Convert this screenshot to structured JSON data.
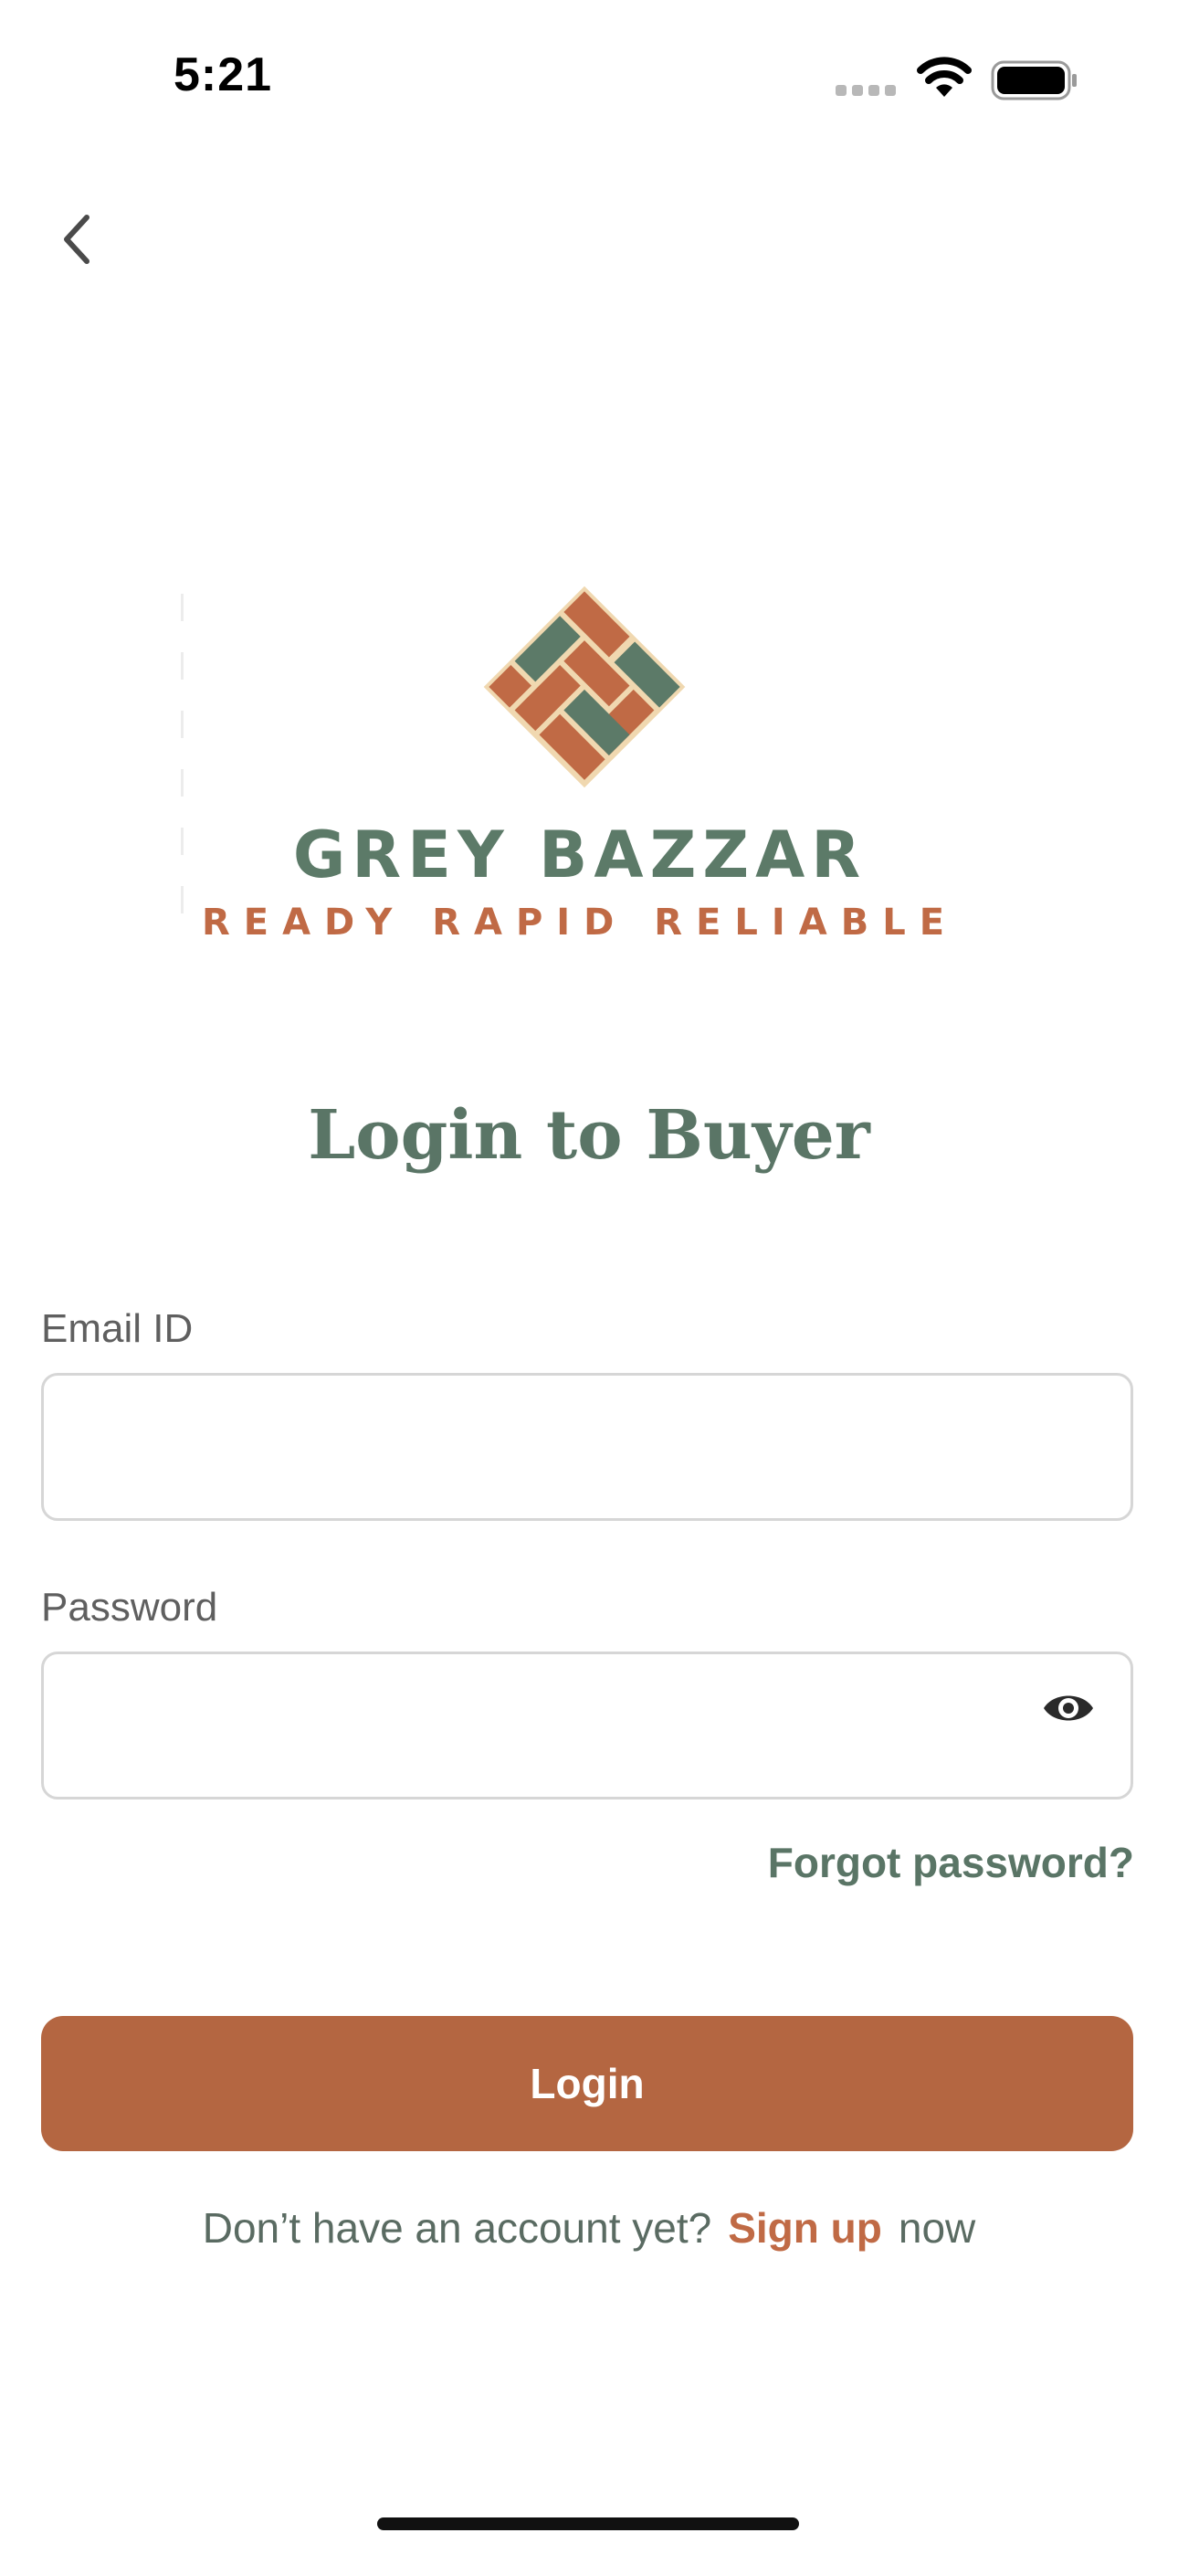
{
  "status_bar": {
    "time": "5:21"
  },
  "brand": {
    "name": "GREY BAZZAR",
    "tagline": "READY RAPID RELIABLE",
    "colors": {
      "green": "#5c7a68",
      "terracotta": "#c06a45",
      "beige": "#f0d8b0"
    }
  },
  "page": {
    "title": "Login to Buyer"
  },
  "form": {
    "email": {
      "label": "Email ID",
      "value": "",
      "placeholder": ""
    },
    "password": {
      "label": "Password",
      "value": "",
      "placeholder": ""
    },
    "forgot_password": "Forgot password?",
    "login_button": "Login"
  },
  "signup": {
    "prefix": "Don’t have an account yet?",
    "link": "Sign up",
    "suffix": "now"
  },
  "icons": {
    "back": "chevron-left-icon",
    "eye": "eye-icon",
    "wifi": "wifi-icon",
    "battery": "battery-icon",
    "signal": "signal-icon"
  }
}
